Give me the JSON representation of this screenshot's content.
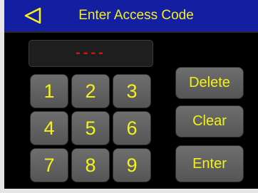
{
  "header": {
    "title": "Enter Access Code",
    "back_icon": "back-triangle-icon"
  },
  "display": {
    "value": "----"
  },
  "keypad": {
    "keys": [
      "1",
      "2",
      "3",
      "4",
      "5",
      "6",
      "7",
      "8",
      "9"
    ]
  },
  "actions": {
    "delete_label": "Delete",
    "clear_label": "Clear",
    "enter_label": "Enter"
  },
  "colors": {
    "title_bar": "#141ea0",
    "text_accent": "#f2f21a",
    "code_display": "#e01010",
    "key_face": "#606060",
    "background": "#000000"
  }
}
